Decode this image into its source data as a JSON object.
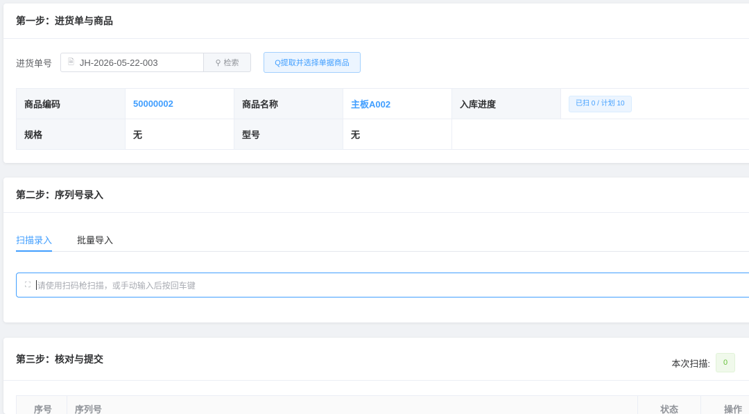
{
  "step1": {
    "title": "第一步：进货单与商品",
    "order_label": "进货单号",
    "order_value": "JH-2026-05-22-003",
    "search_label": "检索",
    "fetch_label": "Q提取并选择单据商品",
    "product": {
      "code_label": "商品编码",
      "code_value": "50000002",
      "name_label": "商品名称",
      "name_value": "主板A002",
      "progress_label": "入库进度",
      "progress_value": "已扫 0 / 计划 10",
      "spec_label": "规格",
      "spec_value": "无",
      "model_label": "型号",
      "model_value": "无"
    }
  },
  "step2": {
    "title": "第二步：序列号录入",
    "tabs": [
      {
        "label": "扫描录入",
        "active": true
      },
      {
        "label": "批量导入",
        "active": false
      }
    ],
    "scan_placeholder": "请使用扫码枪扫描，或手动输入后按回车键"
  },
  "step3": {
    "title": "第三步：核对与提交",
    "scan_count_label": "本次扫描:",
    "scan_count_value": "0",
    "table_headers": [
      "序号",
      "序列号",
      "状态",
      "操作"
    ]
  },
  "colors": {
    "accent": "#409eff",
    "success": "#67c23a"
  }
}
